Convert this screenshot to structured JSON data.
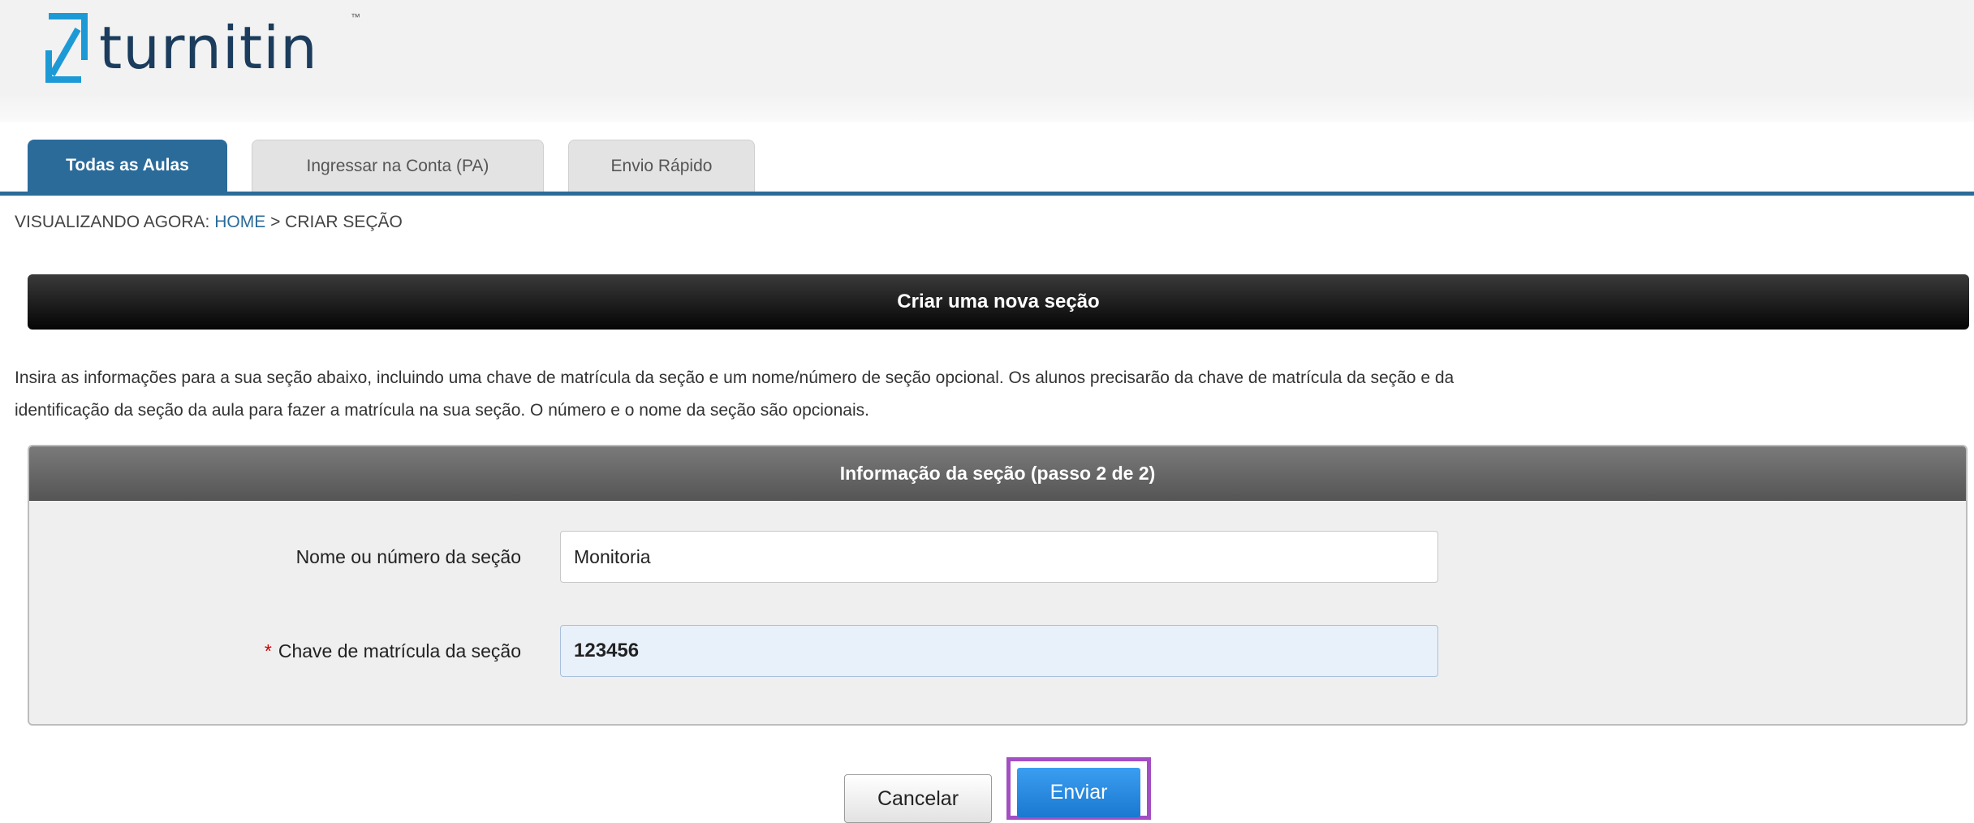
{
  "brand": {
    "name": "turnitin",
    "tm": "™"
  },
  "tabs": [
    {
      "label": "Todas as Aulas",
      "active": true
    },
    {
      "label": "Ingressar na Conta (PA)",
      "active": false
    },
    {
      "label": "Envio Rápido",
      "active": false
    }
  ],
  "breadcrumb": {
    "prefix": "VISUALIZANDO AGORA: ",
    "home": "HOME",
    "separator": " > ",
    "current": "CRIAR SEÇÃO"
  },
  "page_title": "Criar uma nova seção",
  "instructions": {
    "line1": "Insira as informações para a sua seção abaixo, incluindo uma chave de matrícula da seção e um nome/número de seção opcional. Os alunos precisarão da chave de matrícula da seção e da",
    "line2": "identificação da seção da aula para fazer a matrícula na sua seção. O número e o nome da seção são opcionais."
  },
  "panel": {
    "title": "Informação da seção (passo 2 de 2)",
    "fields": {
      "section_name": {
        "label": "Nome ou número da seção",
        "value": "Monitoria"
      },
      "enrollment_key": {
        "required_mark": "*",
        "label": "Chave de matrícula da seção",
        "value": "123456"
      }
    }
  },
  "actions": {
    "cancel": "Cancelar",
    "submit": "Enviar"
  },
  "colors": {
    "brand_blue": "#2b6b9a",
    "logo_text": "#1b3c5c",
    "highlight": "#a34ec3",
    "submit": "#1a78d0"
  },
  "icons": {
    "logo": "turnitin-logo-icon"
  }
}
